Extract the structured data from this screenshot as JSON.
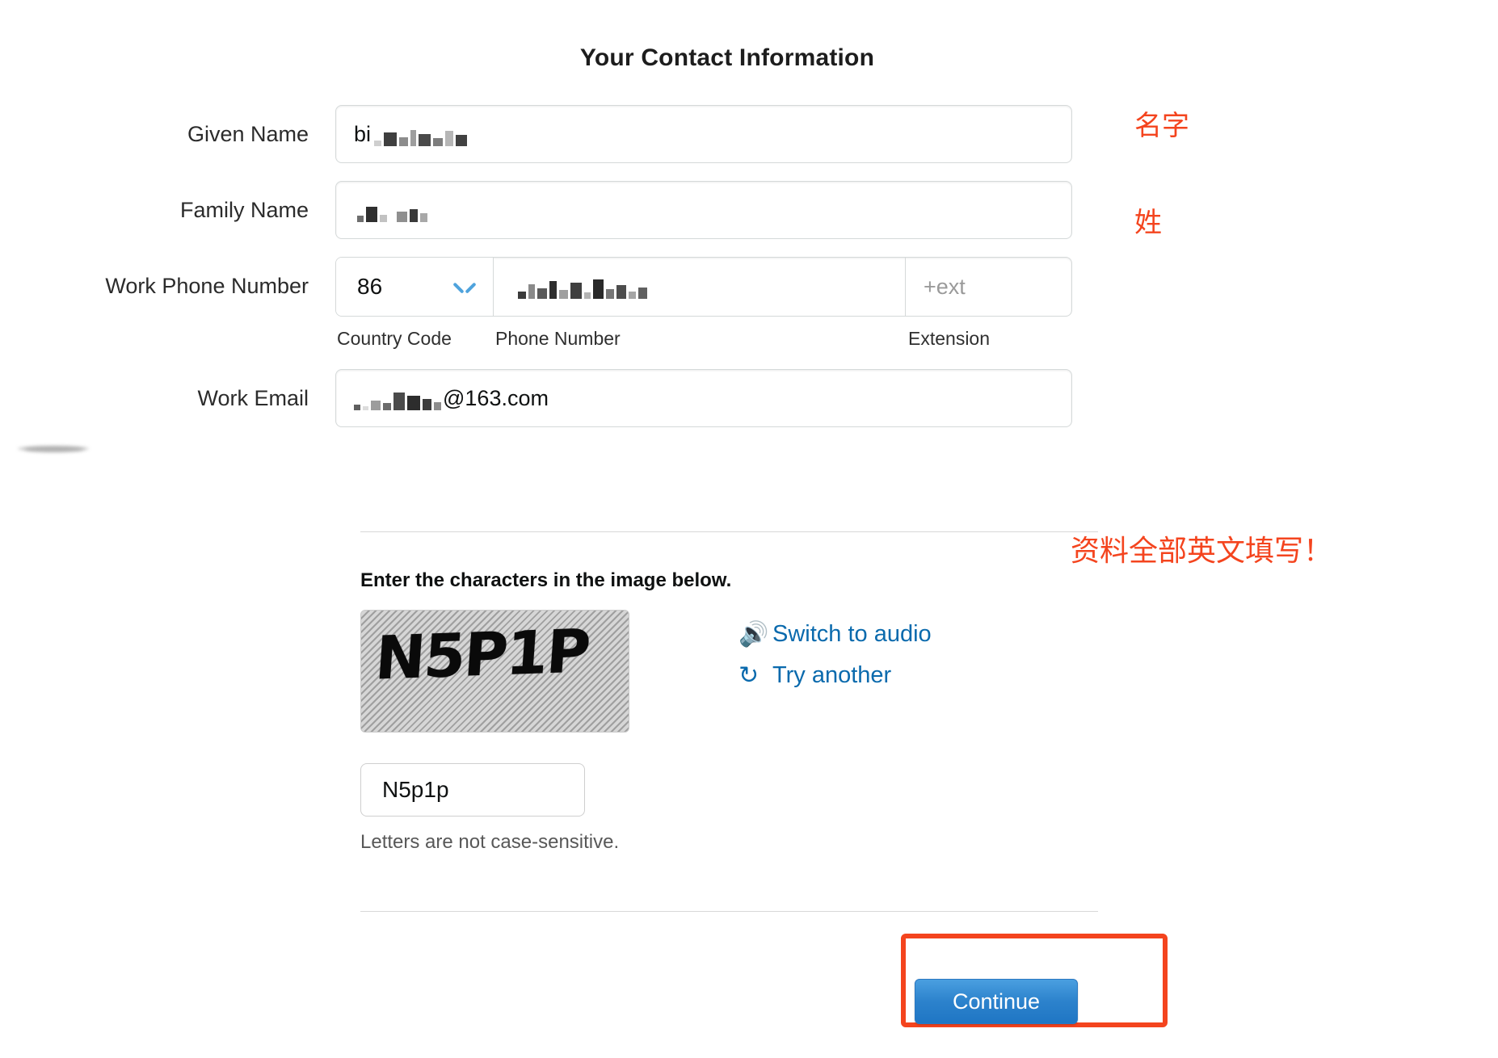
{
  "header": {
    "title": "Your Contact Information"
  },
  "form": {
    "given_name": {
      "label": "Given Name",
      "value_visible": "bi"
    },
    "family_name": {
      "label": "Family Name",
      "value_visible": ""
    },
    "work_phone": {
      "label": "Work Phone Number",
      "country_code": "86",
      "phone_number_visible": "",
      "extension_placeholder": "+ext",
      "sub_labels": {
        "country_code": "Country Code",
        "phone_number": "Phone Number",
        "extension": "Extension"
      }
    },
    "work_email": {
      "label": "Work Email",
      "value_visible": "@163.com"
    }
  },
  "captcha": {
    "prompt": "Enter the characters in the image below.",
    "image_text": "N5P1P",
    "switch_audio_label": "Switch to audio",
    "switch_audio_icon": "speaker-icon",
    "try_another_label": "Try another",
    "try_another_icon": "refresh-icon",
    "input_value": "N5p1p",
    "case_note": "Letters are not case-sensitive."
  },
  "footer": {
    "continue_label": "Continue"
  },
  "annotations": {
    "given_name_cn": "名字",
    "family_name_cn": "姓",
    "english_only_cn": "资料全部英文填写！",
    "color": "#f4441e"
  }
}
